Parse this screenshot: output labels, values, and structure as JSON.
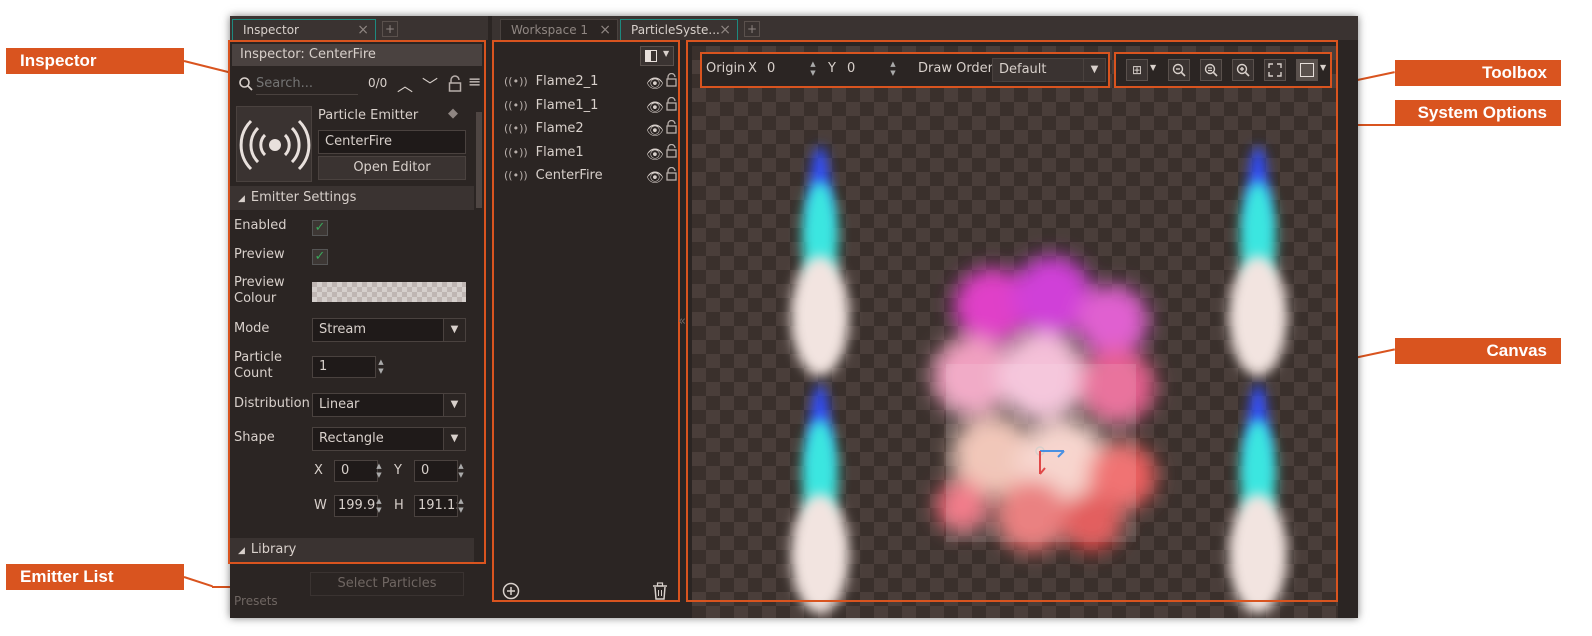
{
  "callouts": {
    "inspector": "Inspector",
    "emitter_list": "Emitter List",
    "toolbox": "Toolbox",
    "system_options": "System Options",
    "canvas": "Canvas"
  },
  "tabs": {
    "inspector": "Inspector",
    "workspace": "Workspace 1",
    "particle_system": "ParticleSyste..."
  },
  "inspector": {
    "title": "Inspector: CenterFire",
    "search_placeholder": "Search...",
    "search_count": "0/0",
    "object_type": "Particle Emitter",
    "emitter_name": "CenterFire",
    "open_editor": "Open Editor",
    "emitter_settings_header": "Emitter Settings",
    "enabled_label": "Enabled",
    "preview_label": "Preview",
    "preview_colour_label_1": "Preview",
    "preview_colour_label_2": "Colour",
    "mode_label": "Mode",
    "mode_value": "Stream",
    "particle_count_label_1": "Particle",
    "particle_count_label_2": "Count",
    "particle_count_value": "1",
    "distribution_label": "Distribution",
    "distribution_value": "Linear",
    "shape_label": "Shape",
    "shape_value": "Rectangle",
    "x_label": "X",
    "x_value": "0",
    "y_label": "Y",
    "y_value": "0",
    "w_label": "W",
    "w_value": "199.9:",
    "h_label": "H",
    "h_value": "191.1:",
    "library_header": "Library",
    "select_particles": "Select Particles",
    "presets_label": "Presets"
  },
  "emitters": [
    {
      "name": "Flame2_1"
    },
    {
      "name": "Flame1_1"
    },
    {
      "name": "Flame2"
    },
    {
      "name": "Flame1"
    },
    {
      "name": "CenterFire"
    }
  ],
  "system_options": {
    "origin_label": "Origin",
    "x_label": "X",
    "x_value": "0",
    "y_label": "Y",
    "y_value": "0",
    "draw_order_label": "Draw Order",
    "draw_order_value": "Default"
  },
  "colors": {
    "accent": "#d9541f",
    "panel_bg": "#2b2523",
    "tab_active": "#1d8a7f"
  }
}
